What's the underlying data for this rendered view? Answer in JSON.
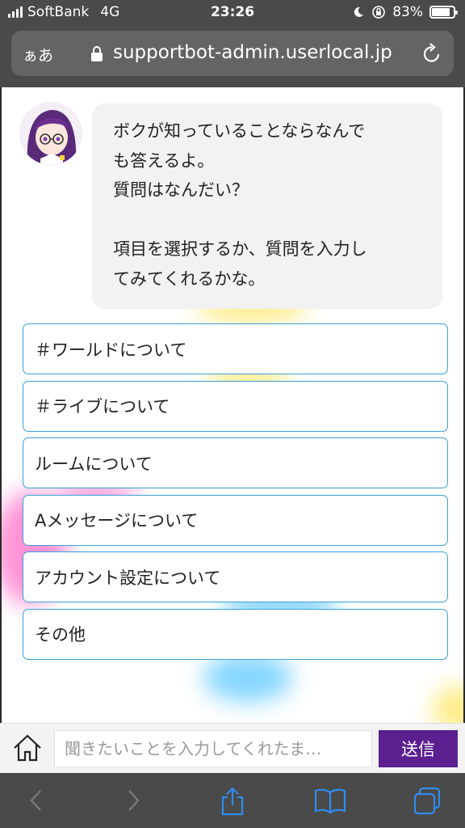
{
  "status_bar": {
    "carrier": "SoftBank",
    "network": "4G",
    "time": "23:26",
    "battery": "83%",
    "battery_level": 0.83
  },
  "browser": {
    "aa_label": "ぁあ",
    "url": "supportbot-admin.userlocal.jp"
  },
  "chat": {
    "bot_message": "ボクが知っていることならなんで\nも答えるよ。\n質問はなんだい？\n\n項目を選択するか、質問を入力し\nてみてくれるかな。"
  },
  "options": [
    "＃ワールドについて",
    "＃ライブについて",
    "ルームについて",
    "Aメッセージについて",
    "アカウント設定について",
    "その他"
  ],
  "input": {
    "placeholder": "聞きたいことを入力してくれたま…",
    "send_label": "送信"
  },
  "colors": {
    "accent": "#5b1f90",
    "option_border": "#3aa0d8",
    "chrome": "#4a4a4a",
    "toolbar_icon": "#2f8cf0"
  }
}
